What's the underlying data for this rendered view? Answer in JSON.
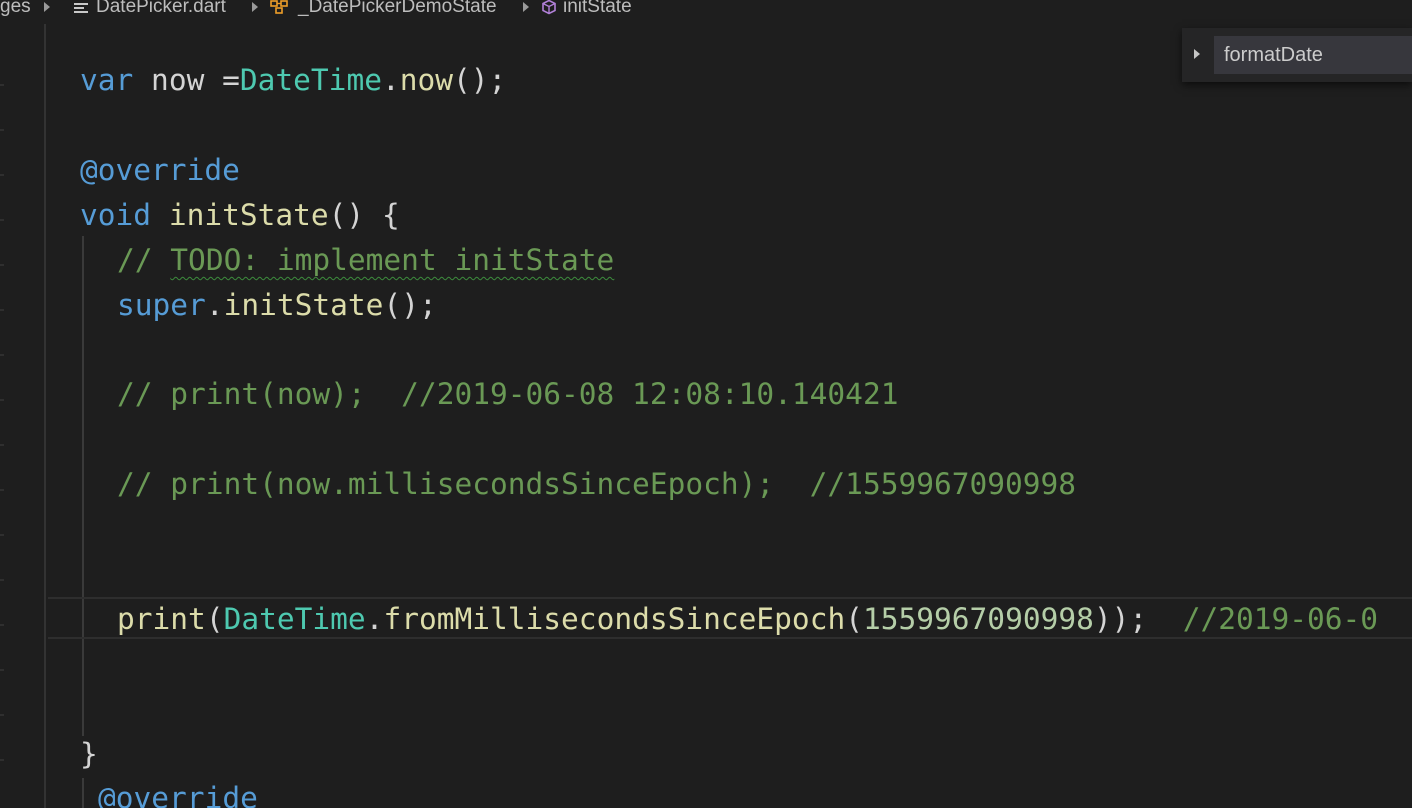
{
  "breadcrumb": {
    "items": [
      {
        "label": "ges",
        "icon": "folder-icon"
      },
      {
        "label": "DatePicker.dart",
        "icon": "file-lines-icon"
      },
      {
        "label": "_DatePickerDemoState",
        "icon": "class-icon"
      },
      {
        "label": "initState",
        "icon": "method-cube-icon"
      }
    ]
  },
  "outline_popup": {
    "item": "formatDate"
  },
  "code": {
    "line1": {
      "kw": "var",
      "plain1": " now =",
      "type": "DateTime",
      "plain2": ".",
      "fn": "now",
      "plain3": "();"
    },
    "line2": {
      "annotation": "@override"
    },
    "line3": {
      "kw": "void",
      "plain1": " ",
      "fn": "initState",
      "plain2": "() {"
    },
    "line4": {
      "comment_prefix": "// ",
      "comment_todo": "TODO: implement initState"
    },
    "line5": {
      "kw": "super",
      "plain1": ".",
      "fn": "initState",
      "plain2": "();"
    },
    "line6": {
      "comment": "// print(now);  //2019-06-08 12:08:10.140421"
    },
    "line7": {
      "comment": "// print(now.millisecondsSinceEpoch);  //1559967090998"
    },
    "line8": {
      "fn1": "print",
      "plain1": "(",
      "type": "DateTime",
      "plain2": ".",
      "fn2": "fromMillisecondsSinceEpoch",
      "plain3": "(",
      "num": "1559967090998",
      "plain4": "));  ",
      "comment": "//2019-06-0"
    },
    "line9": {
      "brace": "}"
    },
    "line10": {
      "annotation": "@override"
    }
  },
  "colors": {
    "background": "#1e1e1e",
    "keyword": "#569cd6",
    "type": "#4ec9b0",
    "function": "#dcdcaa",
    "comment": "#6a9955",
    "number": "#b5cea8",
    "plain": "#d4d4d4"
  }
}
